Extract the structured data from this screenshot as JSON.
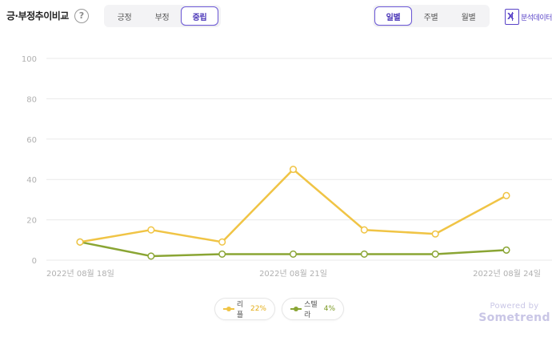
{
  "header": {
    "title": "긍·부정추이비교",
    "help_glyph": "?",
    "sentiment_tabs": [
      {
        "label": "긍정",
        "active": false
      },
      {
        "label": "부정",
        "active": false
      },
      {
        "label": "중립",
        "active": true
      }
    ],
    "period_tabs": [
      {
        "label": "일별",
        "active": true
      },
      {
        "label": "주별",
        "active": false
      },
      {
        "label": "월별",
        "active": false
      }
    ],
    "export_icon_glyph": "X",
    "export_label": "분석데이터"
  },
  "chart_data": {
    "type": "line",
    "categories": [
      "2022년 08월 18일",
      "",
      "",
      "2022년 08월 21일",
      "",
      "",
      "2022년 08월 24일"
    ],
    "x_tick_labels": [
      "2022년 08월 18일",
      "2022년 08월 21일",
      "2022년 08월 24일"
    ],
    "y_ticks": [
      "100",
      "80",
      "60",
      "40",
      "20",
      "0"
    ],
    "ylim": [
      0,
      100
    ],
    "grid": true,
    "legend_position": "bottom-center",
    "series": [
      {
        "name": "리플",
        "share": "22%",
        "color": "#f0c445",
        "values": [
          9,
          15,
          9,
          45,
          15,
          13,
          32
        ]
      },
      {
        "name": "스텔라",
        "share": "4%",
        "color": "#8aa534",
        "values": [
          9,
          2,
          3,
          3,
          3,
          3,
          5
        ]
      }
    ]
  },
  "footer": {
    "powered_by": "Powered by",
    "brand": "Sometrend"
  }
}
